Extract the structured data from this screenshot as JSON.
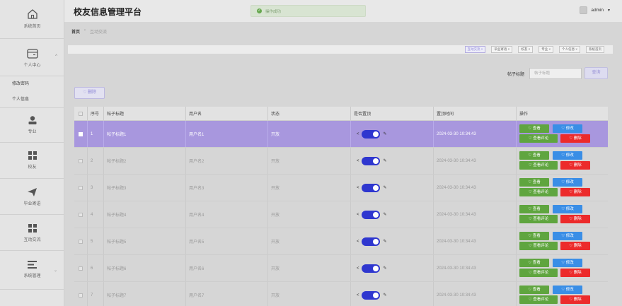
{
  "app_title": "校友信息管理平台",
  "toast": "操作成功",
  "user": {
    "name": "admin",
    "caret": "▼"
  },
  "sidebar": {
    "items": [
      {
        "label": "系统首页"
      },
      {
        "label": "个人中心"
      },
      {
        "label": "专业"
      },
      {
        "label": "校友"
      },
      {
        "label": "毕业寄语"
      },
      {
        "label": "互动交流"
      },
      {
        "label": "系统管理"
      }
    ],
    "sub_items": [
      {
        "label": "修改密码"
      },
      {
        "label": "个人信息"
      }
    ]
  },
  "breadcrumb": {
    "home": "首页",
    "separator": "›",
    "current": "互动交流"
  },
  "tabs": [
    "互动交流 ×",
    "毕业寄语 ×",
    "校友 ×",
    "专业 ×",
    "个人信息 ×",
    "系统首页"
  ],
  "search": {
    "label": "帖子标题",
    "placeholder": "帖子标题",
    "button": "查询"
  },
  "delete_button": "♡ 删除",
  "table": {
    "columns": [
      "序号",
      "帖子标题",
      "用户名",
      "状态",
      "是否置顶",
      "置顶时间",
      "操作"
    ],
    "rows": [
      {
        "no": "1",
        "title": "帖子标题1",
        "user": "用户名1",
        "status": "开放",
        "time": "2024-03-30 10:34:43"
      },
      {
        "no": "2",
        "title": "帖子标题2",
        "user": "用户名2",
        "status": "开放",
        "time": "2024-03-30 10:34:43"
      },
      {
        "no": "3",
        "title": "帖子标题3",
        "user": "用户名3",
        "status": "开放",
        "time": "2024-03-30 10:34:43"
      },
      {
        "no": "4",
        "title": "帖子标题4",
        "user": "用户名4",
        "status": "开放",
        "time": "2024-03-30 10:34:43"
      },
      {
        "no": "5",
        "title": "帖子标题5",
        "user": "用户名5",
        "status": "开放",
        "time": "2024-03-30 10:34:43"
      },
      {
        "no": "6",
        "title": "帖子标题6",
        "user": "用户名6",
        "status": "开放",
        "time": "2024-03-30 10:34:43"
      },
      {
        "no": "7",
        "title": "帖子标题7",
        "user": "用户名7",
        "status": "开放",
        "time": "2024-03-30 10:34:43"
      }
    ],
    "actions": {
      "view": "♡ 查看",
      "edit": "♡ 修改",
      "comments": "♡ 查看评论",
      "delete": "♡ 删除"
    }
  },
  "colors": {
    "selected_row": "#a897de",
    "toggle_on": "#2f37cf",
    "view": "#5fa53f",
    "edit": "#3a8ee6",
    "delete": "#ec2b2b"
  }
}
